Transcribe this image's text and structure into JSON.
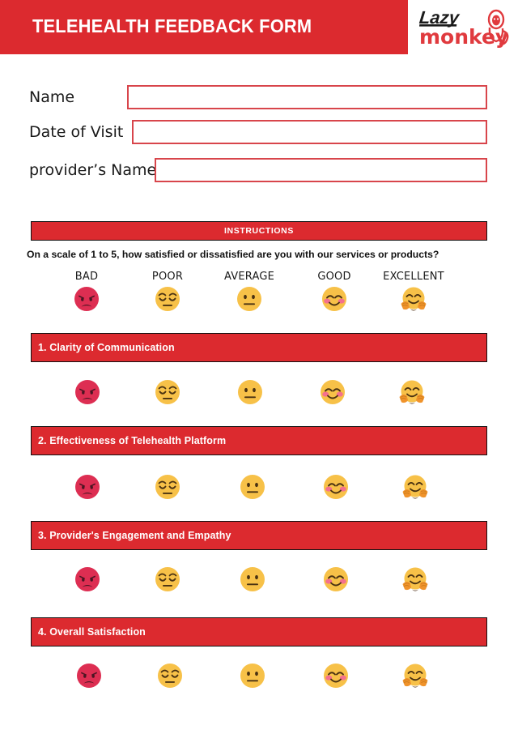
{
  "header": {
    "title": "TELEHEALTH FEEDBACK FORM",
    "bar_color": "#DC2A2F",
    "logo": {
      "word_top": "Lazy",
      "word_bottom": "monkey",
      "icon": "monkey-icon"
    }
  },
  "fields": [
    {
      "label": "Name",
      "value": "",
      "placeholder": ""
    },
    {
      "label": "Date of Visit",
      "value": "",
      "placeholder": ""
    },
    {
      "label": "provider’s Name",
      "value": "",
      "placeholder": ""
    }
  ],
  "instructions": {
    "banner": "INSTRUCTIONS",
    "question": "On a scale of 1 to 5, how satisfied or dissatisfied are you with our services or products?"
  },
  "scale": {
    "options": [
      {
        "label": "BAD",
        "icon": "angry-face-emoji"
      },
      {
        "label": "POOR",
        "icon": "pensive-face-emoji"
      },
      {
        "label": "AVERAGE",
        "icon": "neutral-face-emoji"
      },
      {
        "label": "GOOD",
        "icon": "smiling-face-with-smiling-eyes-emoji"
      },
      {
        "label": "EXCELLENT",
        "icon": "hugging-face-emoji"
      }
    ]
  },
  "questions": [
    {
      "label": "1. Clarity of Communication"
    },
    {
      "label": "2. Effectiveness of Telehealth Platform"
    },
    {
      "label": "3. Provider's Engagement and Empathy"
    },
    {
      "label": "4. Overall Satisfaction"
    }
  ],
  "colors": {
    "red": "#DC2A2F",
    "input_border": "#D8454B",
    "bar_border": "#111111",
    "emoji_yellow": "#F8C council",
    "angry_red": "#DD2E52"
  }
}
